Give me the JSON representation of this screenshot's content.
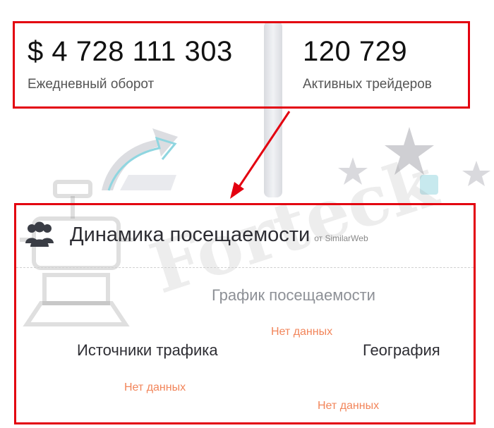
{
  "stats": [
    {
      "value": "$ 4 728 111 303",
      "label": "Ежедневный оборот"
    },
    {
      "value": "120 729",
      "label": "Активных трейдеров"
    }
  ],
  "watermark": "Forteck",
  "traffic": {
    "title": "Динамика посещаемости",
    "source": "от SimilarWeb",
    "sections": {
      "chart": {
        "title": "График посещаемости",
        "status": "Нет данных"
      },
      "sources": {
        "title": "Источники трафика",
        "status": "Нет данных"
      },
      "geo": {
        "title": "География",
        "status": "Нет данных"
      }
    }
  },
  "icons": [
    "users-icon",
    "growth-arrow-icon",
    "star-icon"
  ],
  "colors": {
    "highlight": "#e3000f",
    "no_data": "#f2855a",
    "text": "#2d2d33"
  }
}
